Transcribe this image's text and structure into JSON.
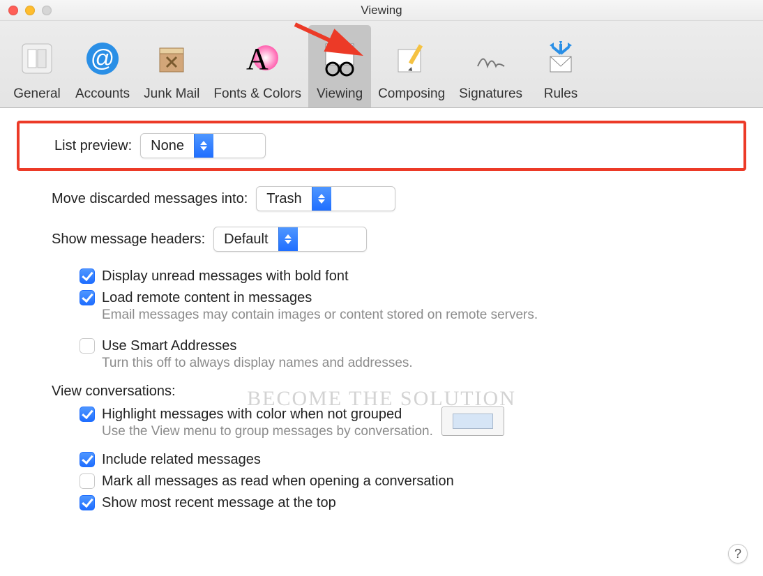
{
  "window": {
    "title": "Viewing"
  },
  "toolbar": {
    "items": [
      {
        "label": "General"
      },
      {
        "label": "Accounts"
      },
      {
        "label": "Junk Mail"
      },
      {
        "label": "Fonts & Colors"
      },
      {
        "label": "Viewing"
      },
      {
        "label": "Composing"
      },
      {
        "label": "Signatures"
      },
      {
        "label": "Rules"
      }
    ],
    "selected": "Viewing"
  },
  "settings": {
    "list_preview_label": "List preview:",
    "list_preview_value": "None",
    "move_discarded_label": "Move discarded messages into:",
    "move_discarded_value": "Trash",
    "show_headers_label": "Show message headers:",
    "show_headers_value": "Default",
    "bold_unread": {
      "label": "Display unread messages with bold font",
      "checked": true
    },
    "load_remote": {
      "label": "Load remote content in messages",
      "checked": true,
      "hint": "Email messages may contain images or content stored on remote servers."
    },
    "smart_addresses": {
      "label": "Use Smart Addresses",
      "checked": false,
      "hint": "Turn this off to always display names and addresses."
    },
    "view_conversations_label": "View conversations:",
    "highlight_color": {
      "label": "Highlight messages with color when not grouped",
      "checked": true,
      "hint": "Use the View menu to group messages by conversation.",
      "color": "#d6e5f6"
    },
    "include_related": {
      "label": "Include related messages",
      "checked": true
    },
    "mark_all_read": {
      "label": "Mark all messages as read when opening a conversation",
      "checked": false
    },
    "recent_top": {
      "label": "Show most recent message at the top",
      "checked": true
    }
  },
  "watermark": "BECOME THE SOLUTION",
  "help_label": "?"
}
